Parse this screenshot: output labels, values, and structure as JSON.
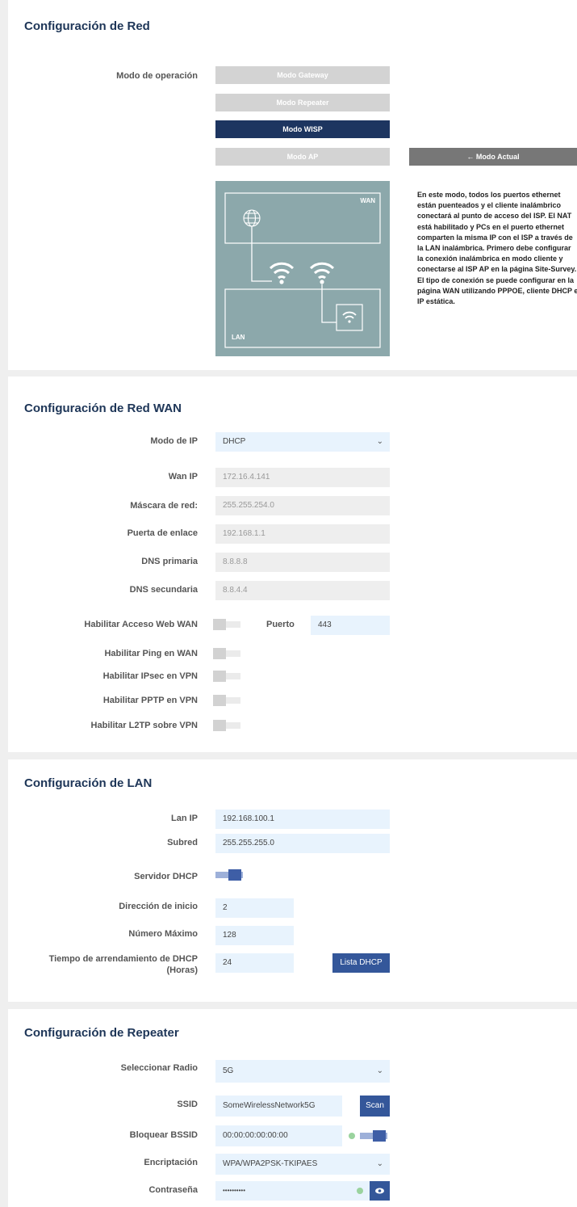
{
  "network": {
    "title": "Configuración de Red",
    "mode_label": "Modo de operación",
    "modes": [
      "Modo Gateway",
      "Modo Repeater",
      "Modo WISP",
      "Modo AP"
    ],
    "active_mode": "Modo WISP",
    "current_label": "← Modo Actual",
    "diagram": {
      "wan": "WAN",
      "lan": "LAN"
    },
    "description": "En este modo, todos los puertos ethernet están puenteados y el cliente inalámbrico conectará al punto de acceso del ISP. El NAT está habilitado y PCs en el puerto ethernet comparten la misma IP con el ISP a través de la LAN inalámbrica. Primero debe configurar la conexión inalámbrica en modo cliente y conectarse al ISP AP en la página Site-Survey. El tipo de conexión se puede configurar en la página WAN utilizando PPPOE, cliente DHCP e IP estática."
  },
  "wan": {
    "title": "Configuración de Red WAN",
    "ip_mode_label": "Modo de IP",
    "ip_mode_value": "DHCP",
    "wan_ip_label": "Wan IP",
    "wan_ip_value": "172.16.4.141",
    "mask_label": "Máscara de red:",
    "mask_value": "255.255.254.0",
    "gateway_label": "Puerta de enlace",
    "gateway_value": "192.168.1.1",
    "dns1_label": "DNS primaria",
    "dns1_value": "8.8.8.8",
    "dns2_label": "DNS secundaria",
    "dns2_value": "8.8.4.4",
    "web_access_label": "Habilitar Acceso Web WAN",
    "port_label": "Puerto",
    "port_value": "443",
    "ping_label": "Habilitar Ping en WAN",
    "ipsec_label": "Habilitar IPsec en VPN",
    "pptp_label": "Habilitar PPTP en VPN",
    "l2tp_label": "Habilitar L2TP sobre VPN"
  },
  "lan": {
    "title": "Configuración de LAN",
    "lan_ip_label": "Lan IP",
    "lan_ip_value": "192.168.100.1",
    "subnet_label": "Subred",
    "subnet_value": "255.255.255.0",
    "dhcp_label": "Servidor DHCP",
    "start_label": "Dirección de inicio",
    "start_value": "2",
    "max_label": "Número Máximo",
    "max_value": "128",
    "lease_label_1": "Tiempo de arrendamiento de DHCP",
    "lease_label_2": "(Horas)",
    "lease_value": "24",
    "dhcp_list_button": "Lista DHCP"
  },
  "repeater": {
    "title": "Configuración de Repeater",
    "radio_label": "Seleccionar Radio",
    "radio_value": "5G",
    "ssid_label": "SSID",
    "ssid_value": "SomeWirelessNetwork5G",
    "scan_button": "Scan",
    "bssid_label": "Bloquear BSSID",
    "bssid_value": "00:00:00:00:00:00",
    "encryption_label": "Encriptación",
    "encryption_value": "WPA/WPA2PSK-TKIPAES",
    "password_label": "Contraseña",
    "password_value": "••••••••••"
  },
  "colors": {
    "accent": "#1d3560",
    "button": "#34579a",
    "diagram": "#8ca8ab"
  }
}
